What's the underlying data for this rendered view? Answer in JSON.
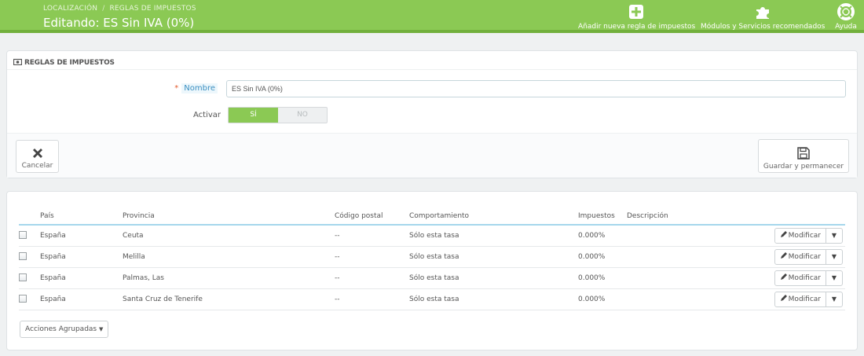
{
  "header": {
    "breadcrumb": [
      "LOCALIZACIÓN",
      "REGLAS DE IMPUESTOS"
    ],
    "breadcrumb_separator": "/",
    "title": "Editando: ES Sin IVA (0%)",
    "toolbar": [
      {
        "label": "Añadir nueva regla de impuestos",
        "icon": "plus-square-icon"
      },
      {
        "label": "Módulos y Servicios recomendados",
        "icon": "puzzle-icon"
      },
      {
        "label": "Ayuda",
        "icon": "lifebuoy-icon"
      }
    ],
    "accent": "#8bc954"
  },
  "form": {
    "section_title": "REGLAS DE IMPUESTOS",
    "required_mark": "*",
    "name_label": "Nombre",
    "name_value": "ES Sin IVA (0%)",
    "active_label": "Activar",
    "switch_on": "SÍ",
    "switch_off": "NO",
    "cancel_label": "Cancelar",
    "save_label": "Guardar y permanecer"
  },
  "rules_table": {
    "columns": [
      "País",
      "Provincia",
      "Código postal",
      "Comportamiento",
      "Impuestos",
      "Descripción"
    ],
    "rows": [
      {
        "country": "España",
        "province": "Ceuta",
        "zip": "--",
        "behavior": "Sólo esta tasa",
        "tax": "0.000%",
        "description": "",
        "action": "Modificar"
      },
      {
        "country": "España",
        "province": "Melilla",
        "zip": "--",
        "behavior": "Sólo esta tasa",
        "tax": "0.000%",
        "description": "",
        "action": "Modificar"
      },
      {
        "country": "España",
        "province": "Palmas, Las",
        "zip": "--",
        "behavior": "Sólo esta tasa",
        "tax": "0.000%",
        "description": "",
        "action": "Modificar"
      },
      {
        "country": "España",
        "province": "Santa Cruz de Tenerife",
        "zip": "--",
        "behavior": "Sólo esta tasa",
        "tax": "0.000%",
        "description": "",
        "action": "Modificar"
      }
    ],
    "bulk_label": "Acciones Agrupadas"
  }
}
